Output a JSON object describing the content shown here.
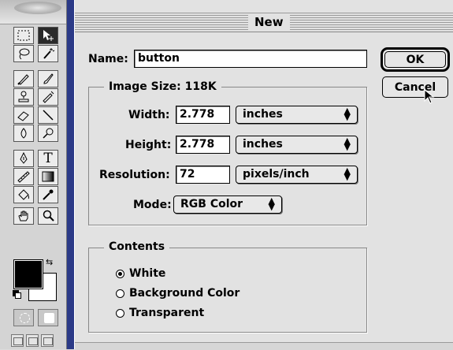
{
  "dialog": {
    "title": "New",
    "name_label": "Name:",
    "name_value": "button",
    "ok_label": "OK",
    "cancel_label": "Cancel",
    "image_size": {
      "group_label": "Image Size: 118K",
      "width_label": "Width:",
      "width_value": "2.778",
      "width_unit": "inches",
      "height_label": "Height:",
      "height_value": "2.778",
      "height_unit": "inches",
      "resolution_label": "Resolution:",
      "resolution_value": "72",
      "resolution_unit": "pixels/inch",
      "mode_label": "Mode:",
      "mode_value": "RGB Color"
    },
    "contents": {
      "group_label": "Contents",
      "options": [
        "White",
        "Background Color",
        "Transparent"
      ],
      "selected": "White"
    }
  },
  "toolbox": {
    "tools": [
      "marquee-tool-icon",
      "move-tool-icon",
      "lasso-tool-icon",
      "magic-wand-tool-icon",
      "airbrush-tool-icon",
      "paintbrush-tool-icon",
      "rubber-stamp-tool-icon",
      "history-brush-tool-icon",
      "eraser-tool-icon",
      "line-tool-icon",
      "blur-tool-icon",
      "dodge-tool-icon",
      "pen-tool-icon",
      "type-tool-icon",
      "measure-tool-icon",
      "gradient-tool-icon",
      "paint-bucket-tool-icon",
      "eyedropper-tool-icon",
      "hand-tool-icon",
      "zoom-tool-icon"
    ],
    "type_glyph": "T",
    "foreground_color": "#000000",
    "background_color": "#ffffff"
  },
  "colors": {
    "document_strip": "#2b3a87",
    "dialog_background": "#e2e2e2"
  }
}
